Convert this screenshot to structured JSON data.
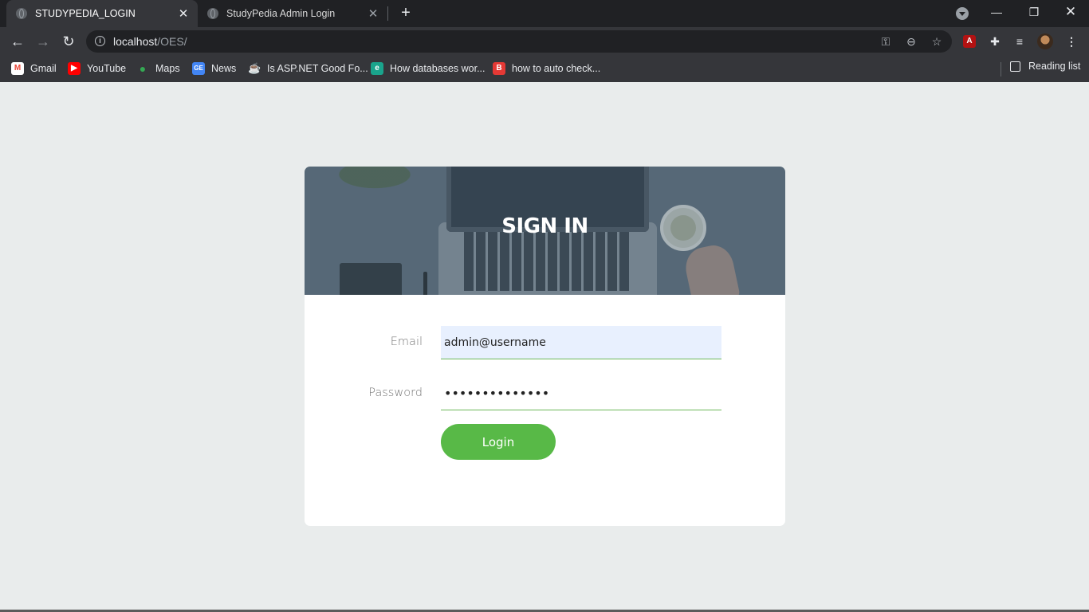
{
  "browser": {
    "tabs": [
      {
        "title": "STUDYPEDIA_LOGIN",
        "active": true
      },
      {
        "title": "StudyPedia Admin Login",
        "active": false
      }
    ],
    "url_host": "localhost",
    "url_path": "/OES/",
    "bookmarks": [
      {
        "label": "Gmail",
        "icon": "gmail-icon",
        "color": "#ea4335"
      },
      {
        "label": "YouTube",
        "icon": "youtube-icon",
        "color": "#ff0000"
      },
      {
        "label": "Maps",
        "icon": "maps-icon",
        "color": "#34a853"
      },
      {
        "label": "News",
        "icon": "news-icon",
        "color": "#4285f4"
      },
      {
        "label": "Is ASP.NET Good Fo...",
        "icon": "cup-icon",
        "color": "#e8eaed"
      },
      {
        "label": "How databases wor...",
        "icon": "educative-icon",
        "color": "#1aa48c"
      },
      {
        "label": "how to auto check...",
        "icon": "b-icon",
        "color": "#e53935"
      }
    ],
    "reading_list": "Reading list"
  },
  "login": {
    "title": "SIGN IN",
    "email_label": "Email",
    "email_value": "admin@username",
    "password_label": "Password",
    "password_value": "••••••••••••••",
    "button_label": "Login",
    "accent_color": "#58b947",
    "autofill_color": "#e8f0fe"
  }
}
